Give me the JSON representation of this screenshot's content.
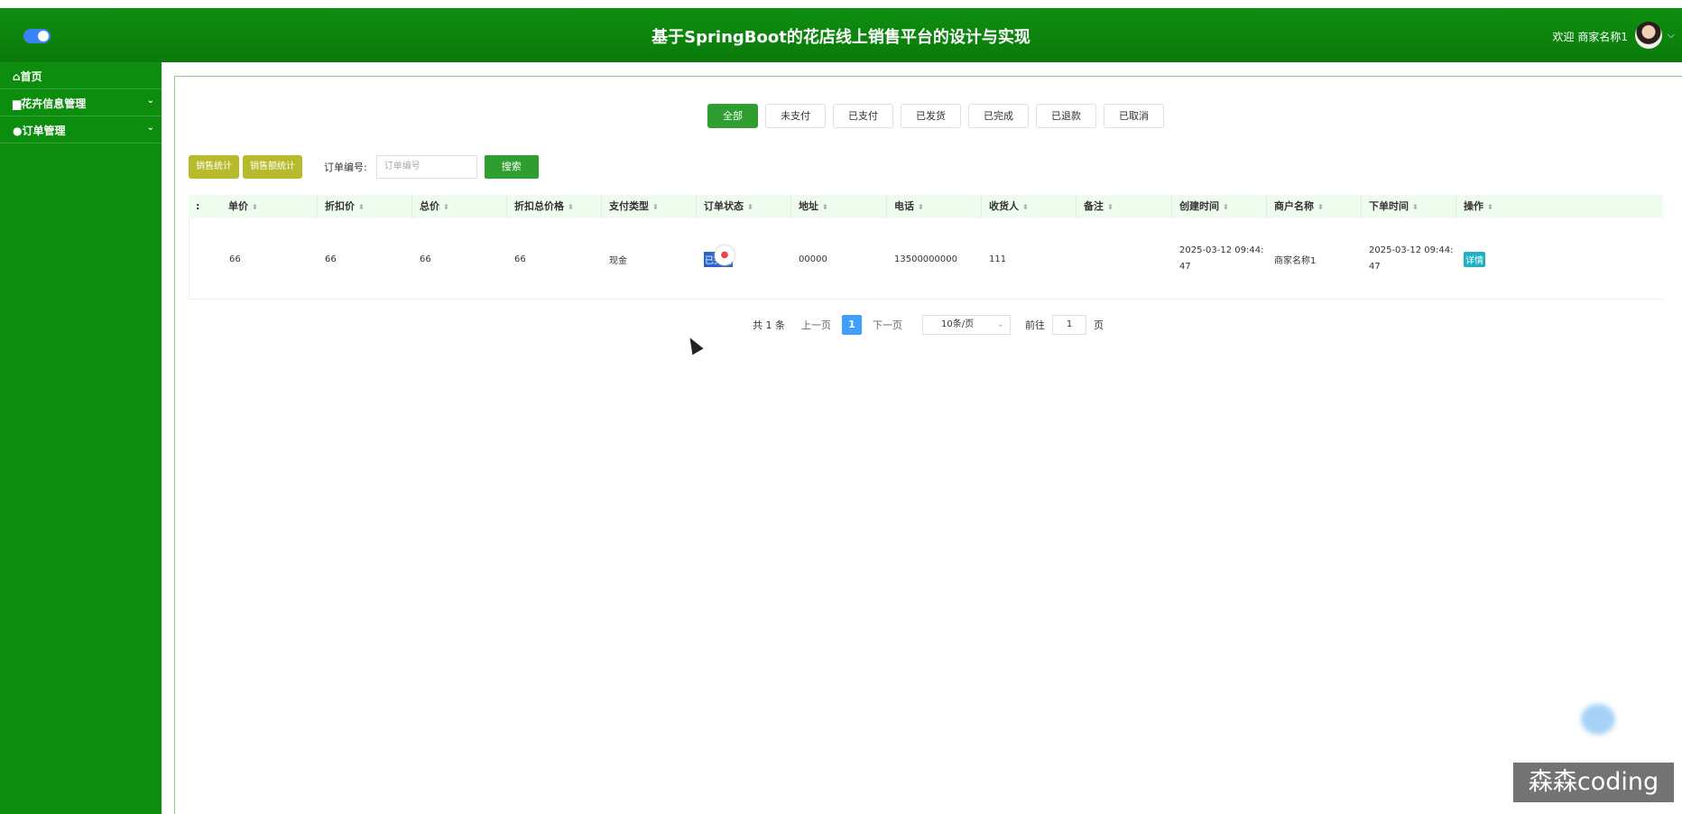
{
  "header": {
    "title": "基于SpringBoot的花店线上销售平台的设计与实现",
    "welcome": "欢迎 商家名称1",
    "caret": "⌵"
  },
  "sidebar": {
    "items": [
      {
        "label": "⌂首页"
      },
      {
        "label": "▆花卉信息管理",
        "chevron": "⌄"
      },
      {
        "label": "●订单管理",
        "chevron": "⌄"
      }
    ]
  },
  "tabs": [
    "全部",
    "未支付",
    "已支付",
    "已发货",
    "已完成",
    "已退款",
    "已取消"
  ],
  "toolbar": {
    "btn1": "销售统计",
    "btn2": "销售额统计",
    "search_label": "订单编号:",
    "search_placeholder": "订单编号",
    "search_btn": "搜索"
  },
  "table": {
    "first_col_glyph": ":",
    "sort_glyph": "⬍",
    "columns": [
      "单价",
      "折扣价",
      "总价",
      "折扣总价格",
      "支付类型",
      "订单状态",
      "地址",
      "电话",
      "收货人",
      "备注",
      "创建时间",
      "商户名称",
      "下单时间",
      "操作"
    ],
    "row": {
      "unit_price": "66",
      "discount_price": "66",
      "total_price": "66",
      "discount_total": "66",
      "pay_type": "现金",
      "status": "已完成",
      "address": "00000",
      "phone": "13500000000",
      "receiver": "111",
      "remark": "",
      "created_at_1": "2025-03-12 09:44:",
      "created_at_2": "47",
      "merchant": "商家名称1",
      "order_time_1": "2025-03-12 09:44:",
      "order_time_2": "47",
      "action": "详情"
    }
  },
  "pagination": {
    "total": "共 1 条",
    "prev": "上一页",
    "current": "1",
    "next": "下一页",
    "page_size": "10条/页",
    "goto_label": "前往",
    "goto_value": "1",
    "page_unit": "页"
  },
  "watermark": "森森coding",
  "colors": {
    "header_green": "#0f8f10",
    "sidebar_green": "#0d8d0e",
    "accent": "#2e9e30",
    "pager_blue": "#409eff"
  }
}
